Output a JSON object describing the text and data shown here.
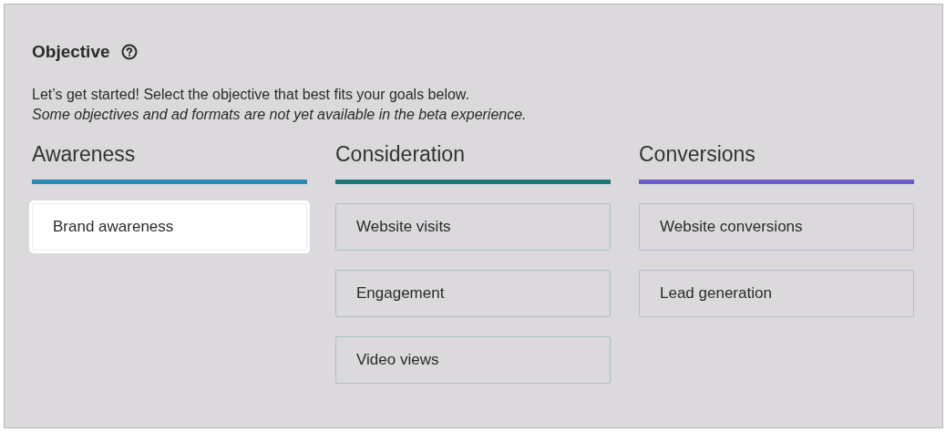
{
  "title": "Objective",
  "intro": "Let’s get started! Select the objective that best fits your goals below.",
  "note": "Some objectives and ad formats are not yet available in the beta experience.",
  "categories": [
    {
      "name": "Awareness",
      "color": "#2a8ab5",
      "options": [
        {
          "label": "Brand awareness",
          "selected": true
        }
      ]
    },
    {
      "name": "Consideration",
      "color": "#177a78",
      "options": [
        {
          "label": "Website visits",
          "selected": false
        },
        {
          "label": "Engagement",
          "selected": false
        },
        {
          "label": "Video views",
          "selected": false
        }
      ]
    },
    {
      "name": "Conversions",
      "color": "#6a5ccc",
      "options": [
        {
          "label": "Website conversions",
          "selected": false
        },
        {
          "label": "Lead generation",
          "selected": false
        }
      ]
    }
  ]
}
